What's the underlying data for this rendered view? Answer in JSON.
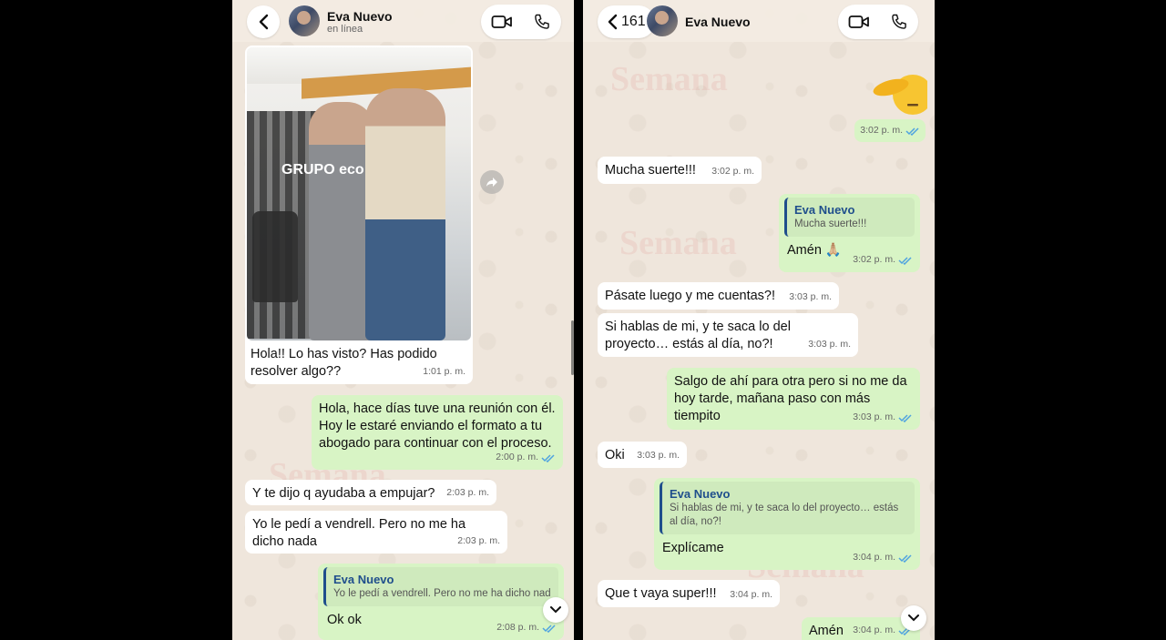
{
  "left": {
    "header": {
      "contact_name": "Eva Nuevo",
      "status": "en línea"
    },
    "messages": [
      {
        "id": "m1",
        "side": "in",
        "text": "Hola!! Lo has visto? Has podido resolver algo??",
        "time": "1:01 p. m."
      },
      {
        "id": "m2",
        "side": "out",
        "text": "Hola, hace días tuve una reunión con él. Hoy le estaré enviando el formato a tu abogado para continuar con el proceso.",
        "time": "2:00 p. m."
      },
      {
        "id": "m3",
        "side": "in",
        "text": "Y te dijo q ayudaba a empujar?",
        "time": "2:03 p. m."
      },
      {
        "id": "m4",
        "side": "in",
        "text": "Yo le pedí a vendrell. Pero no me ha dicho nada",
        "time": "2:03 p. m."
      },
      {
        "id": "m5",
        "side": "out",
        "quote_name": "Eva Nuevo",
        "quote_text": "Yo le pedí a vendrell. Pero no me ha dicho nada",
        "text": "Ok ok",
        "time": "2:08 p. m."
      }
    ],
    "photo_text": "GRUPO eco"
  },
  "right": {
    "header": {
      "back_count": "161",
      "contact_name": "Eva Nuevo"
    },
    "messages": [
      {
        "id": "r0",
        "side": "out",
        "emoji": "saluting-face",
        "time": "3:02 p. m."
      },
      {
        "id": "r1",
        "side": "in",
        "text": "Mucha suerte!!!",
        "time": "3:02 p. m."
      },
      {
        "id": "r2",
        "side": "out",
        "quote_name": "Eva Nuevo",
        "quote_text": "Mucha suerte!!!",
        "text": "Amén 🙏🏼",
        "time": "3:02 p. m."
      },
      {
        "id": "r3",
        "side": "in",
        "text": "Pásate luego y me cuentas?!",
        "time": "3:03 p. m."
      },
      {
        "id": "r4",
        "side": "in",
        "text": "Si hablas de mi, y te saca lo del proyecto… estás al día, no?!",
        "time": "3:03 p. m."
      },
      {
        "id": "r5",
        "side": "out",
        "text": "Salgo de ahí para otra pero si no me da hoy tarde, mañana paso con más tiempito",
        "time": "3:03 p. m."
      },
      {
        "id": "r6",
        "side": "in",
        "text": "Oki",
        "time": "3:03 p. m."
      },
      {
        "id": "r7",
        "side": "out",
        "quote_name": "Eva Nuevo",
        "quote_text": "Si hablas de mi, y te saca lo del proyecto… estás al día, no?!",
        "text": "Explícame",
        "time": "3:04 p. m."
      },
      {
        "id": "r8",
        "side": "in",
        "text": "Que t vaya super!!!",
        "time": "3:04 p. m."
      },
      {
        "id": "r9",
        "side": "out",
        "text": "Amén",
        "time": "3:04 p. m."
      }
    ]
  },
  "watermark": "Semana",
  "colors": {
    "incoming_bubble": "#ffffff",
    "outgoing_bubble": "#d8f4c5",
    "chat_background": "#efe6dc",
    "quote_accent": "#1f4e8c",
    "read_ticks": "#4fa3e0"
  },
  "icons": [
    "chevron-left-icon",
    "video-camera-icon",
    "phone-icon",
    "share-arrow-icon",
    "chevron-down-icon",
    "double-check-icon"
  ]
}
